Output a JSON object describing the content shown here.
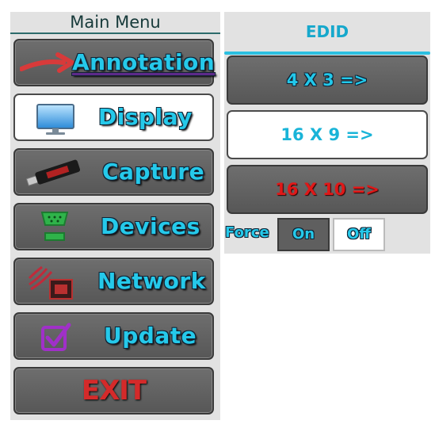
{
  "menu": {
    "title": "Main Menu",
    "items": [
      {
        "label": "Annotation",
        "icon": "red-arrow-icon",
        "active": false
      },
      {
        "label": "Display",
        "icon": "monitor-icon",
        "active": true
      },
      {
        "label": "Capture",
        "icon": "usb-stick-icon",
        "active": false
      },
      {
        "label": "Devices",
        "icon": "serial-port-icon",
        "active": false
      },
      {
        "label": "Network",
        "icon": "wireless-network-icon",
        "active": false
      },
      {
        "label": "Update",
        "icon": "checkbox-icon",
        "active": false
      },
      {
        "label": "EXIT",
        "icon": "",
        "active": false
      }
    ]
  },
  "edid": {
    "title": "EDID",
    "options": [
      {
        "label": "4 X 3 =>",
        "active": false
      },
      {
        "label": "16 X 9 =>",
        "active": true
      },
      {
        "label": "16 X 10 =>",
        "active": false
      }
    ],
    "force": {
      "label": "Force",
      "on": "On",
      "off": "Off"
    }
  },
  "colors": {
    "accent": "#25c9ea",
    "button": "#5f5f5f",
    "exit": "#d42a2a",
    "highlight": "#e01818"
  }
}
